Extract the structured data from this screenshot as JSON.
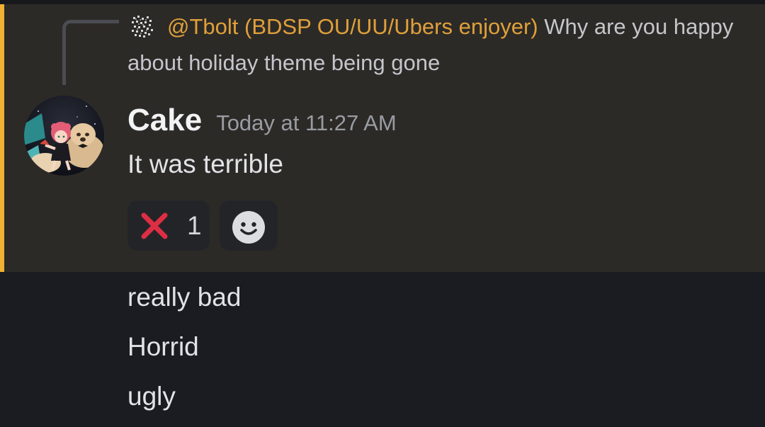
{
  "reply": {
    "username": "@Tbolt (BDSP OU/UU/Ubers enjoyer)",
    "text": "Why are you happy about holiday theme being gone",
    "avatar_icon": "pixel-avatar-icon"
  },
  "message": {
    "author": "Cake",
    "timestamp": "Today at 11:27 AM",
    "avatar_icon": "anime-avatar-icon",
    "text": "It was terrible"
  },
  "reactions": [
    {
      "icon": "cross-mark-icon",
      "count": "1"
    }
  ],
  "add_reaction_icon": "add-reaction-smile-icon",
  "followups": [
    "really bad",
    "Horrid",
    "ugly"
  ],
  "colors": {
    "mention_accent": "#f0b232",
    "reply_username": "#e0a03a",
    "background": "#1b1c21",
    "highlight_background": "#2c2a27"
  }
}
